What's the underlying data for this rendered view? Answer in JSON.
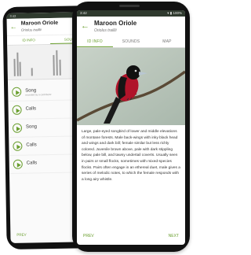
{
  "back_phone": {
    "status_time": "3:42",
    "title": "Maroon Oriole",
    "subtitle": "Oriolus traillii",
    "tabs": [
      {
        "label": "ID INFO",
        "active": false
      },
      {
        "label": "SOUNDS",
        "active": true
      }
    ],
    "recordings": [
      {
        "label": "Song",
        "sub": "recorded by a contributor"
      },
      {
        "label": "Calls",
        "sub": ""
      },
      {
        "label": "Song",
        "sub": ""
      },
      {
        "label": "Calls",
        "sub": ""
      },
      {
        "label": "Calls",
        "sub": ""
      }
    ],
    "prev_label": "PREV"
  },
  "front_phone": {
    "status_time": "3:42",
    "status_right": "▾ ▮ 100%",
    "title": "Maroon Oriole",
    "subtitle": "Oriolus traillii",
    "tabs": [
      {
        "label": "ID INFO",
        "active": true
      },
      {
        "label": "SOUNDS",
        "active": false
      },
      {
        "label": "MAP",
        "active": false
      }
    ],
    "description": "Large, pale-eyed songbird of lower and middle elevations of montane forests. Male back-wings with inky black head and wings and dark bill; female similar but less richly colored. Juvenile brown above, pale with dark stippling below, pale bill, and tawny undertail coverts. Usually seen in pairs or small flocks, sometimes with mixed-species flocks. Pairs often engage in an ethereal duet, male gives a series of melodic notes, to which the female responds with a long airy whistle.",
    "prev_label": "PREV",
    "next_label": "NEXT"
  },
  "colors": {
    "accent": "#6a9f2e",
    "bird_body": "#b0142a",
    "bird_head": "#111111"
  },
  "icons": {
    "back": "back-arrow-icon",
    "play": "play-icon"
  }
}
